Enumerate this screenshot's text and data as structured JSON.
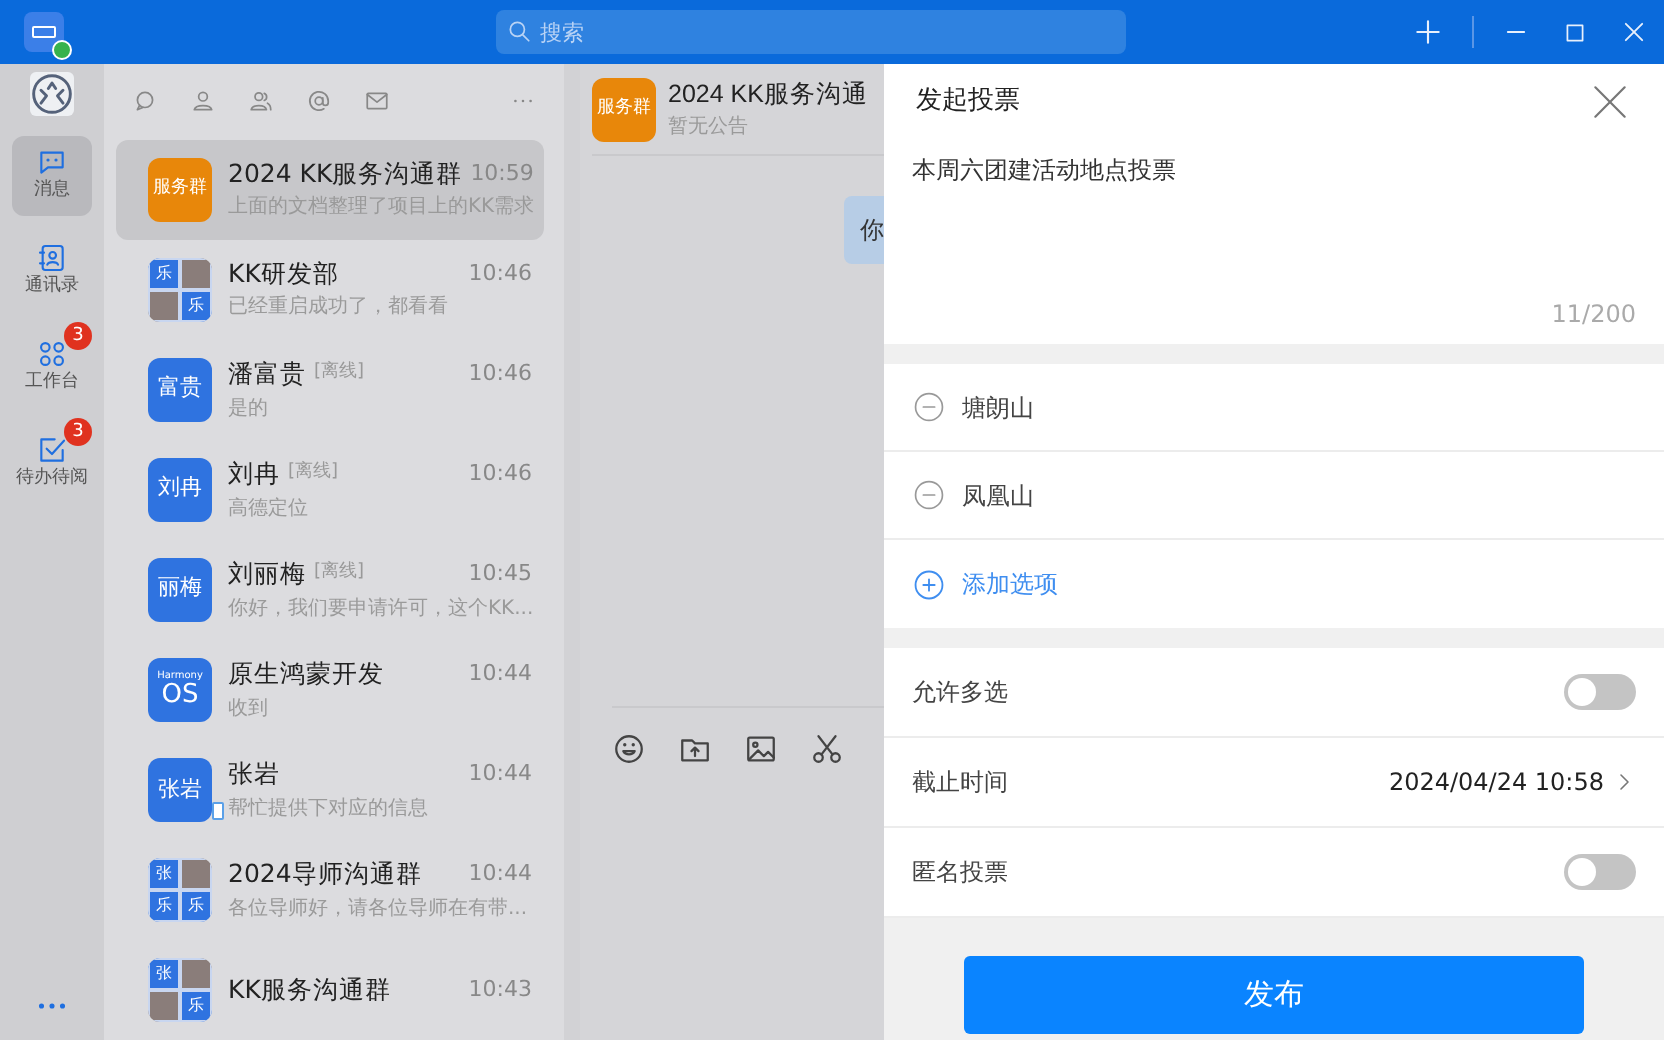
{
  "app": {
    "online": true
  },
  "search": {
    "placeholder": "搜索"
  },
  "nav": {
    "items": [
      {
        "label": "消息",
        "selected": true
      },
      {
        "label": "通讯录",
        "selected": false
      },
      {
        "label": "工作台",
        "selected": false,
        "badge": "3"
      },
      {
        "label": "待办待阅",
        "selected": false,
        "badge": "3"
      }
    ]
  },
  "conversations": [
    {
      "name": "2024 KK服务沟通群",
      "time": "10:59",
      "preview": "上面的文档整理了项目上的KK需求",
      "selected": true,
      "avatar": {
        "kind": "text",
        "text": "服务群",
        "color": "#e8870a"
      }
    },
    {
      "name": "KK研发部",
      "time": "10:46",
      "preview": "已经重启成功了，都看看",
      "selected": false,
      "avatar": {
        "kind": "group",
        "tiles": [
          {
            "kind": "text",
            "text": "乐"
          },
          {
            "kind": "photo"
          },
          {
            "kind": "photo"
          },
          {
            "kind": "text",
            "text": "乐"
          }
        ]
      }
    },
    {
      "name": "潘富贵",
      "status": "[离线]",
      "time": "10:46",
      "preview": "是的",
      "selected": false,
      "avatar": {
        "kind": "text",
        "text": "富贵",
        "color": "#2f73e0"
      }
    },
    {
      "name": "刘冉",
      "status": "[离线]",
      "time": "10:46",
      "preview": "高德定位",
      "selected": false,
      "avatar": {
        "kind": "text",
        "text": "刘冉",
        "color": "#2f73e0"
      }
    },
    {
      "name": "刘丽梅",
      "status": "[离线]",
      "time": "10:45",
      "preview": "你好，我们要申请许可，这个KK...",
      "selected": false,
      "avatar": {
        "kind": "text",
        "text": "丽梅",
        "color": "#2f73e0"
      }
    },
    {
      "name": "原生鸿蒙开发",
      "time": "10:44",
      "preview": "收到",
      "selected": false,
      "avatar": {
        "kind": "os",
        "caption": "Harmony",
        "text": "OS",
        "color": "#2f73e0"
      }
    },
    {
      "name": "张岩",
      "time": "10:44",
      "preview": "帮忙提供下对应的信息",
      "selected": false,
      "mobile": true,
      "avatar": {
        "kind": "text",
        "text": "张岩",
        "color": "#2f73e0"
      }
    },
    {
      "name": "2024导师沟通群",
      "time": "10:44",
      "preview": "各位导师好，请各位导师在有带...",
      "selected": false,
      "avatar": {
        "kind": "group",
        "tiles": [
          {
            "kind": "text",
            "text": "张"
          },
          {
            "kind": "photo"
          },
          {
            "kind": "text",
            "text": "乐"
          },
          {
            "kind": "text",
            "text": "乐"
          }
        ]
      }
    },
    {
      "name": "KK服务沟通群",
      "time": "10:43",
      "selected": false,
      "avatar": {
        "kind": "group",
        "tiles": [
          {
            "kind": "text",
            "text": "张"
          },
          {
            "kind": "photo"
          },
          {
            "kind": "photo"
          },
          {
            "kind": "text",
            "text": "乐"
          }
        ]
      }
    }
  ],
  "chat": {
    "title": "2024 KK服务沟通",
    "notice": "暂无公告",
    "avatar": {
      "kind": "text",
      "text": "服务群",
      "color": "#e8870a"
    },
    "bubble": "你"
  },
  "poll": {
    "title": "发起投票",
    "question": "本周六团建活动地点投票",
    "counter": "11/200",
    "options": [
      "塘朗山",
      "凤凰山"
    ],
    "add_option": "添加选项",
    "settings": [
      {
        "kind": "toggle",
        "label": "允许多选",
        "on": false
      },
      {
        "kind": "link",
        "label": "截止时间",
        "value": "2024/04/24 10:58"
      },
      {
        "kind": "toggle",
        "label": "匿名投票",
        "on": false
      }
    ],
    "submit": "发布"
  }
}
